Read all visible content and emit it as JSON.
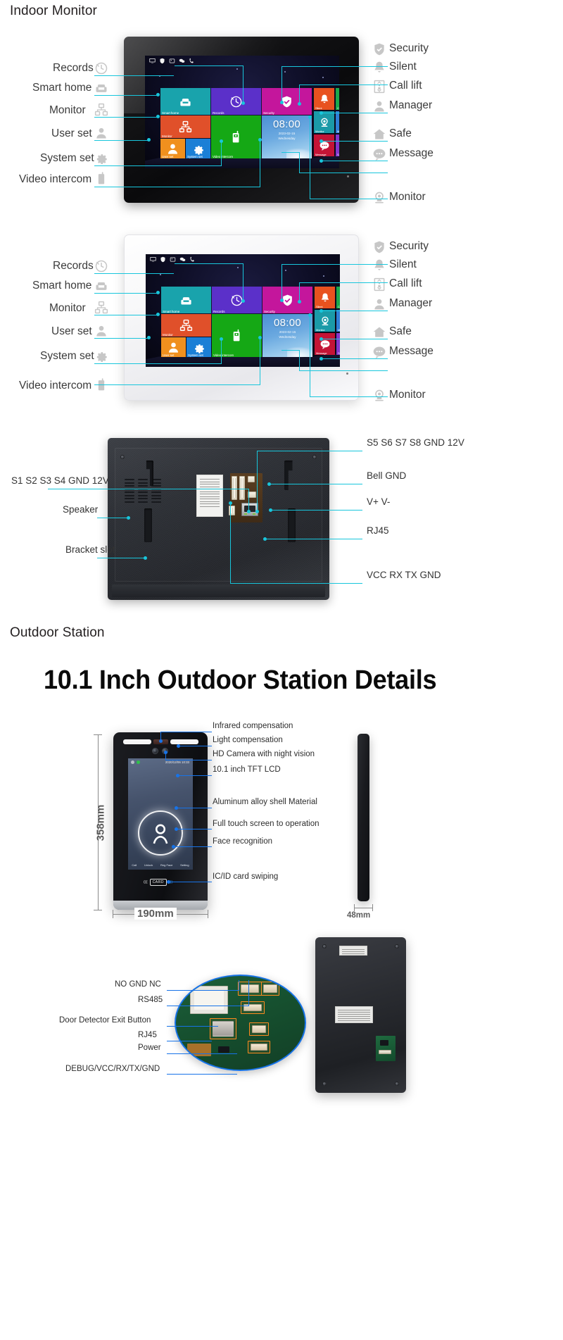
{
  "sections": {
    "indoor_title": "Indoor Monitor",
    "outdoor_title": "Outdoor Station",
    "outdoor_headline": "10.1 Inch Outdoor Station Details"
  },
  "monitor_ui": {
    "clock": {
      "time": "08:00",
      "date": "2023-02-15",
      "day": "Wednesday"
    },
    "tiles": [
      {
        "label": "Smart home",
        "icon": "sofa-icon",
        "color": "#19a3ac"
      },
      {
        "label": "Records",
        "icon": "clock-icon",
        "color": "#5b30c9"
      },
      {
        "label": "Security",
        "icon": "shield-icon",
        "color": "#c4169c"
      },
      {
        "label": "Monitor",
        "icon": "network-icon",
        "color": "#e0502a"
      },
      {
        "label": "Video intercom",
        "icon": "handset-icon",
        "color": "#15a815"
      },
      {
        "label": "User set",
        "icon": "user-icon",
        "color": "#f0901e"
      },
      {
        "label": "System set",
        "icon": "gear-icon",
        "color": "#1b7fd6"
      },
      {
        "label": "Silent",
        "icon": "bell-icon",
        "color": "#e8521f"
      },
      {
        "label": "Call lift",
        "icon": "lift-icon",
        "color": "#1ba94c"
      },
      {
        "label": "Monitor",
        "icon": "camera-icon",
        "color": "#1b9aa8"
      },
      {
        "label": "Manager",
        "icon": "manager-icon",
        "color": "#2f7fd8"
      },
      {
        "label": "Message",
        "icon": "message-icon",
        "color": "#c41436"
      },
      {
        "label": "Safe",
        "icon": "safe-home-icon",
        "color": "#8436cc"
      }
    ]
  },
  "indoor_callouts": {
    "left": [
      {
        "label": "Records",
        "icon": "clock-icon"
      },
      {
        "label": "Smart home",
        "icon": "sofa-icon"
      },
      {
        "label": "Monitor",
        "icon": "network-icon"
      },
      {
        "label": "User set",
        "icon": "user-icon"
      },
      {
        "label": "System set",
        "icon": "gear-icon"
      },
      {
        "label": "Video intercom",
        "icon": "handset-icon"
      }
    ],
    "right": [
      {
        "label": "Security",
        "icon": "shield-icon"
      },
      {
        "label": "Silent",
        "icon": "bell-icon"
      },
      {
        "label": "Call lift",
        "icon": "lift-icon"
      },
      {
        "label": "Manager",
        "icon": "manager-icon"
      },
      {
        "label": "Safe",
        "icon": "safe-home-icon"
      },
      {
        "label": "Message",
        "icon": "message-icon"
      },
      {
        "label": "Monitor",
        "icon": "camera-icon"
      }
    ]
  },
  "back_panel_callouts": {
    "left": [
      "S1 S2 S3 S4 GND 12V",
      "Speaker",
      "Bracket slot"
    ],
    "right": [
      "S5 S6 S7 S8 GND 12V",
      "Bell GND",
      "V+ V-",
      "RJ45",
      "VCC RX TX GND"
    ]
  },
  "outdoor_station": {
    "callouts": [
      "Infrared compensation",
      "Light compensation",
      "HD Camera with night vision",
      "10.1 inch TFT LCD",
      "Aluminum alloy shell Material",
      "Full touch screen to operation",
      "Face recognition",
      "IC/ID card swiping"
    ],
    "dimensions": {
      "height": "358mm",
      "width": "190mm",
      "depth": "48mm"
    },
    "screen": {
      "timestamp": "2020/12/06 10:33",
      "card_text": "CARD",
      "menu": [
        "Call",
        "Unlock",
        "Reg Face",
        "Setting"
      ]
    }
  },
  "pcb_callouts": [
    "NO GND NC",
    "RS485",
    "Door Detector Exit Button",
    "RJ45",
    "Power",
    "DEBUG/VCC/RX/TX/GND"
  ],
  "colors": {
    "leader_cyan": "#18c6dc",
    "leader_blue": "#1773e8",
    "highlight_orange": "#ff8a1f"
  }
}
